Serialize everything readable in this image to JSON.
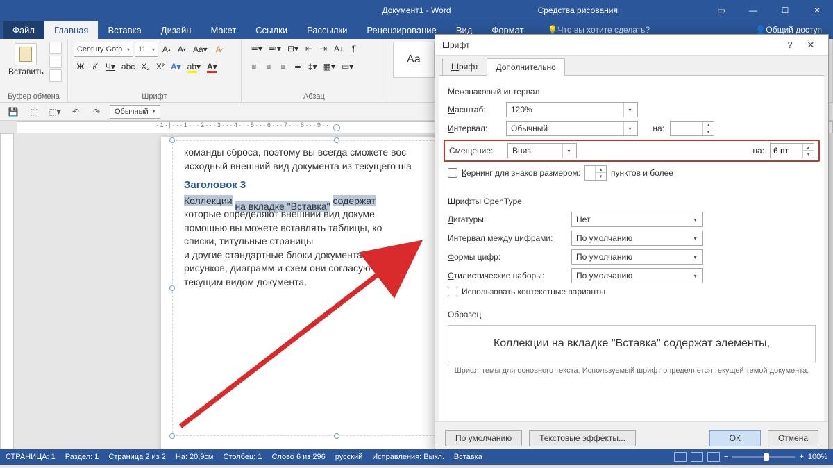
{
  "titlebar": {
    "title": "Документ1 - Word",
    "drawing_tools": "Средства рисования"
  },
  "ribbon_tabs": {
    "file": "Файл",
    "tabs": [
      "Главная",
      "Вставка",
      "Дизайн",
      "Макет",
      "Ссылки",
      "Рассылки",
      "Рецензирование",
      "Вид",
      "Формат"
    ],
    "active": "Главная",
    "tell_me": "Что вы хотите сделать?",
    "share": "Общий доступ"
  },
  "ribbon": {
    "clipboard": {
      "paste": "Вставить",
      "label": "Буфер обмена"
    },
    "font": {
      "name": "Century Goth",
      "size": "11",
      "bold": "Ж",
      "italic": "К",
      "underline": "Ч",
      "strike": "abc",
      "sub": "X₂",
      "sup": "X²",
      "label": "Шрифт"
    },
    "paragraph": {
      "label": "Абзац"
    }
  },
  "quickbar": {
    "style": "Обычный"
  },
  "ruler": "· 1 ·  |  · · · 1 · · · 2 · · · 3 · · · 4 · · · 5 · · · 6 · · · 7 · · · 8 · · · 9 · ·",
  "document": {
    "top1": "команды сброса, поэтому вы всегда сможете вос",
    "top2": "исходный внешний вид документа из текущего ша",
    "heading": "Заголовок 3",
    "sel1": "Коллекции",
    "sel2": "на вкладке \"Вставка\"",
    "sel3": "содержат",
    "p1": "которые определяют внешний вид докуме",
    "p2": "помощью вы можете вставлять таблицы, ко",
    "p3": "списки, титульные страницы",
    "p4": "и другие стандартные блоки документа. П",
    "p5": "рисунков, диаграмм и схем они согласую",
    "p6": "текущим видом документа."
  },
  "dialog": {
    "title": "Шрифт",
    "tab_font_u": "Ш",
    "tab_font": "рифт",
    "tab_adv_u": "Д",
    "tab_adv": "ополнительно",
    "section_spacing": "Межзнаковый интервал",
    "scale_lbl_u": "М",
    "scale_lbl": "асштаб:",
    "scale_val": "120%",
    "spacing_lbl_u": "И",
    "spacing_lbl": "нтервал:",
    "spacing_val": "Обычный",
    "spacing_by": "на:",
    "spacing_by_val": "",
    "position_lbl": "Смещение:",
    "position_val": "Вниз",
    "position_by": "на:",
    "position_by_val": "6 пт",
    "kerning_lbl_u": "К",
    "kerning_lbl": "ернинг для знаков размером:",
    "kerning_after": "пунктов и более",
    "section_opentype": "Шрифты OpenType",
    "ligatures_lbl_u": "Л",
    "ligatures_lbl": "игатуры:",
    "ligatures_val": "Нет",
    "numspacing_lbl": "Интервал между цифрами:",
    "numspacing_val": "По умолчанию",
    "numform_lbl_u": "Ф",
    "numform_lbl": "ормы цифр:",
    "numform_val": "По умолчанию",
    "styleset_lbl_u": "С",
    "styleset_lbl": "тилистические наборы:",
    "styleset_val": "По умолчанию",
    "contextual": "Использовать контекстные варианты",
    "sample_lbl": "Образец",
    "sample_text": "Коллекции на вкладке \"Вставка\" содержат элементы,",
    "sample_note": "Шрифт темы для основного текста. Используемый шрифт определяется текущей темой документа.",
    "btn_default": "По умолчанию",
    "btn_default_u": "ю",
    "btn_effects": "Текстовые эффекты...",
    "btn_effects_u": "э",
    "btn_ok": "ОК",
    "btn_cancel": "Отмена"
  },
  "statusbar": {
    "page": "СТРАНИЦА: 1",
    "section": "Раздел: 1",
    "pages": "Страница 2 из 2",
    "at": "На: 20,9см",
    "col": "Столбец: 1",
    "words": "Слово 6 из 296",
    "lang": "русский",
    "track": "Исправления: Выкл.",
    "insert": "Вставка",
    "zoom": "100%"
  }
}
